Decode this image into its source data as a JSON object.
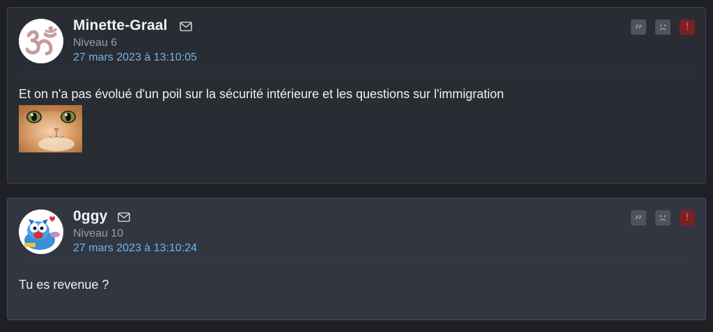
{
  "posts": [
    {
      "username": "Minette-Graal",
      "level": "Niveau 6",
      "date": "27 mars 2023 à 13:10:05",
      "content": "Et on n'a pas évolué d'un poil sur la sécurité intérieure et les questions sur l'immigration",
      "avatar_icon": "om-symbol",
      "has_image": true,
      "image_alt": "cat-closeup"
    },
    {
      "username": "0ggy",
      "level": "Niveau 10",
      "date": "27 mars 2023 à 13:10:24",
      "content": "Tu es revenue ?",
      "avatar_icon": "oggy-cartoon",
      "has_image": false
    }
  ],
  "actions": {
    "quote_glyph": "”",
    "report_glyph": "!"
  },
  "colors": {
    "background": "#1e2025",
    "post_bg": "#2a2c33",
    "post_bg_alt": "#323640",
    "date_link": "#6fb5ea",
    "report": "#d8434a"
  }
}
